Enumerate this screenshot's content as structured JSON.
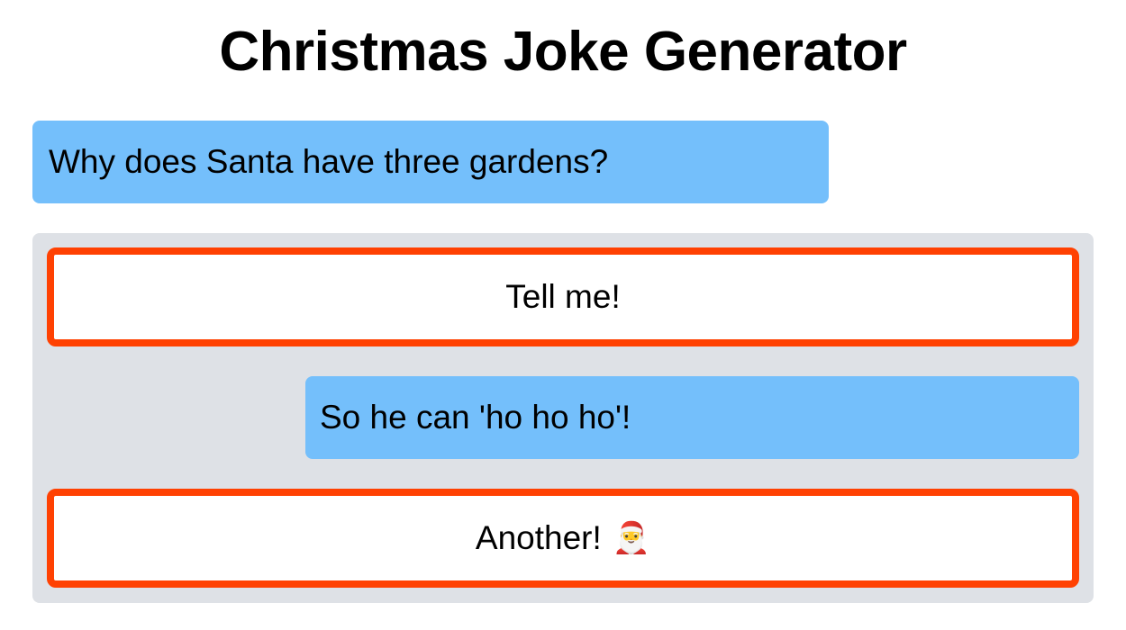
{
  "page": {
    "title": "Christmas Joke Generator"
  },
  "joke": {
    "question": "Why does Santa have three gardens?",
    "answer": "So he can 'ho ho ho'!"
  },
  "buttons": {
    "tell_me_label": "Tell me!",
    "another_label": "Another!",
    "another_emoji": "🎅",
    "another_emoji_icon": "santa-claus-icon"
  },
  "colors": {
    "bubble_background": "#74bffb",
    "panel_background": "#dee1e6",
    "button_border": "#ff4102"
  }
}
